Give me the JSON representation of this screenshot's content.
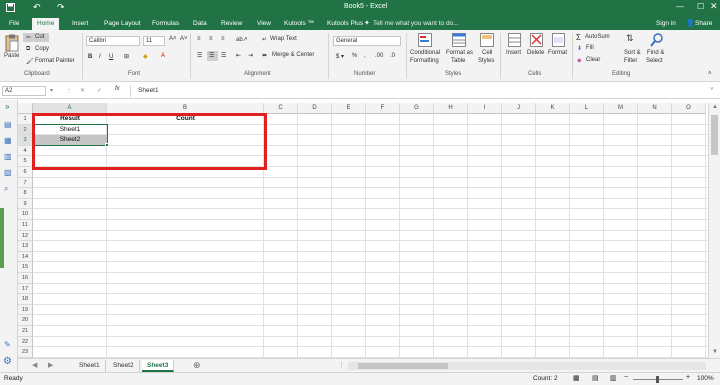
{
  "title": "Book5 - Excel",
  "quick_access": {
    "save_icon": "save-icon",
    "undo_icon": "undo-icon",
    "redo_icon": "redo-icon"
  },
  "header_right": {
    "sign_in": "Sign in",
    "share": "Share"
  },
  "tabs": [
    "File",
    "Home",
    "Insert",
    "Page Layout",
    "Formulas",
    "Data",
    "Review",
    "View",
    "Kutools ™",
    "Kutools Plus"
  ],
  "active_tab": "Home",
  "tell_me": "Tell me what you want to do...",
  "ribbon": {
    "clipboard": {
      "paste": "Paste",
      "cut": "Cut",
      "copy": "Copy",
      "format_painter": "Format Painter",
      "label": "Clipboard"
    },
    "font": {
      "name": "Calibri",
      "size": "11",
      "label": "Font"
    },
    "alignment": {
      "wrap_text": "Wrap Text",
      "merge_center": "Merge & Center",
      "label": "Alignment"
    },
    "number": {
      "format": "General",
      "label": "Number"
    },
    "styles": {
      "conditional": "Conditional",
      "conditional2": "Formatting",
      "format_as": "Format as",
      "format_as2": "Table",
      "cell": "Cell",
      "cell2": "Styles",
      "label": "Styles"
    },
    "cells": {
      "insert": "Insert",
      "delete": "Delete",
      "format": "Format",
      "label": "Cells"
    },
    "editing": {
      "autosum": "AutoSum",
      "fill": "Fill",
      "clear": "Clear",
      "sort": "Sort &",
      "sort2": "Filter",
      "find": "Find &",
      "find2": "Select",
      "label": "Editing"
    }
  },
  "formula_bar": {
    "name_box": "A2",
    "fx": "fx",
    "value": "Sheet1"
  },
  "columns": [
    "A",
    "B",
    "C",
    "D",
    "E",
    "F",
    "G",
    "H",
    "I",
    "J",
    "K",
    "L",
    "M",
    "N",
    "O"
  ],
  "rows": [
    "1",
    "2",
    "3",
    "4",
    "5",
    "6",
    "7",
    "8",
    "9",
    "10",
    "11",
    "12",
    "13",
    "14",
    "15",
    "16",
    "17",
    "18",
    "19",
    "20",
    "21",
    "22",
    "23"
  ],
  "cells": {
    "a1": "Result",
    "b1": "Count",
    "a2": "Sheet1",
    "a3": "Sheet2"
  },
  "sheets": [
    "Sheet1",
    "Sheet2",
    "Sheet3"
  ],
  "active_sheet": "Sheet3",
  "status": {
    "ready": "Ready",
    "count": "Count: 2",
    "zoom": "100%"
  },
  "colors": {
    "brand": "#217346",
    "highlight": "#e02020",
    "selected_fill": "#c6c6c6"
  }
}
